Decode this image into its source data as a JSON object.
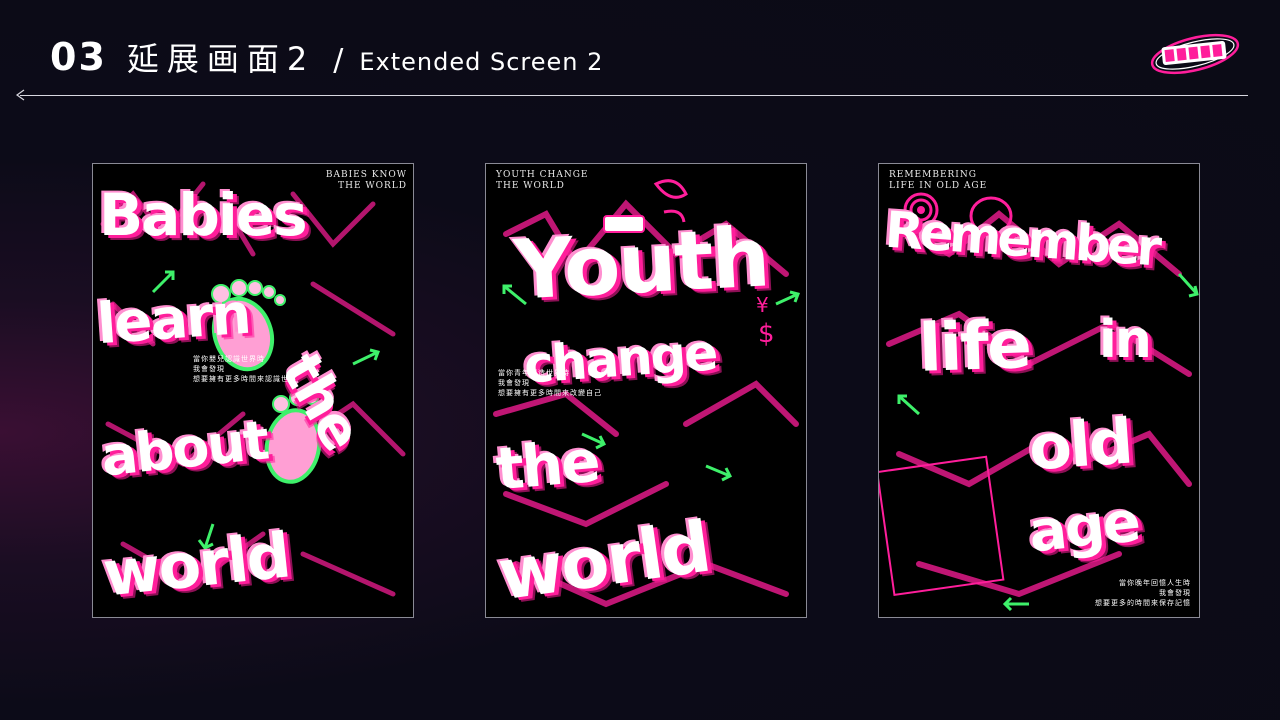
{
  "header": {
    "section_number": "03",
    "title_cn": "延展画面2",
    "slash": "/",
    "title_en": "Extended Screen 2"
  },
  "posters": [
    {
      "corner_text": [
        "BABIES KNOW",
        "THE WORLD"
      ],
      "words": [
        "Babies",
        "learn",
        "about",
        "the",
        "world"
      ],
      "caption": [
        "當你嬰兒認識世界時",
        "我會發現",
        "想要擁有更多時間來認識世界"
      ]
    },
    {
      "corner_text": [
        "YOUTH CHANGE",
        "THE WORLD"
      ],
      "words": [
        "Youth",
        "change",
        "the",
        "world"
      ],
      "caption": [
        "當你青年創造世界時",
        "我會發現",
        "想要擁有更多時間來改變自己"
      ]
    },
    {
      "corner_text": [
        "REMEMBERING",
        "LIFE IN OLD AGE"
      ],
      "words": [
        "Remember",
        "life",
        "in",
        "old",
        "age"
      ],
      "caption": [
        "當你晚年回憶人生時",
        "我會發現",
        "想要更多的時間來保存記憶"
      ]
    }
  ],
  "colors": {
    "accent_pink": "#ff1e9b",
    "accent_green": "#3ef06a",
    "background": "#0b0b16"
  }
}
